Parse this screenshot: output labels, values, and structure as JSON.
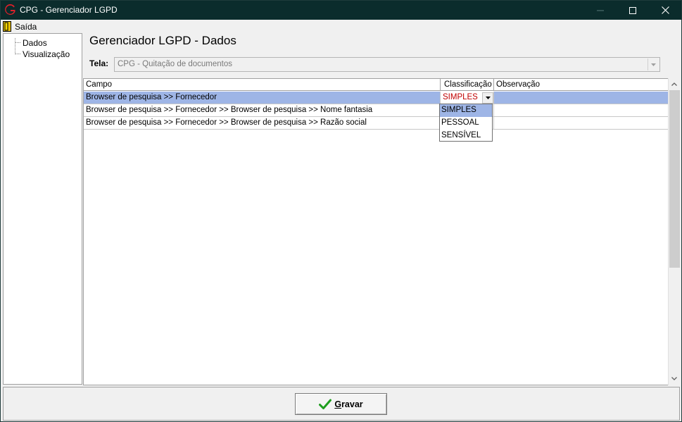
{
  "window": {
    "title": "CPG - Gerenciador LGPD"
  },
  "menu": {
    "exit_label": "Saída"
  },
  "tree": {
    "items": [
      {
        "label": "Dados"
      },
      {
        "label": "Visualização"
      }
    ]
  },
  "main": {
    "title": "Gerenciador LGPD - Dados",
    "tela_label": "Tela:",
    "tela_value": "CPG - Quitação de documentos"
  },
  "grid": {
    "columns": [
      "Campo",
      "Classificação",
      "Observação"
    ],
    "rows": [
      {
        "campo": "Browser de pesquisa >> Fornecedor",
        "classificacao": "SIMPLES",
        "observacao": ""
      },
      {
        "campo": "Browser de pesquisa >> Fornecedor >> Browser de pesquisa >>  Nome fantasia",
        "classificacao": "",
        "observacao": ""
      },
      {
        "campo": "Browser de pesquisa >> Fornecedor >> Browser de pesquisa >>  Razão social",
        "classificacao": "",
        "observacao": ""
      }
    ],
    "editing_value": "SIMPLES",
    "dropdown_options": [
      "SIMPLES",
      "PESSOAL",
      "SENSÍVEL"
    ],
    "dropdown_selected": "SIMPLES"
  },
  "footer": {
    "save_hotkey": "G",
    "save_rest": "ravar"
  },
  "colors": {
    "titlebar": "#0b2c2c",
    "selection": "#9eb5e6",
    "edit_text": "#c00000",
    "save_check": "#1e9e1e"
  }
}
